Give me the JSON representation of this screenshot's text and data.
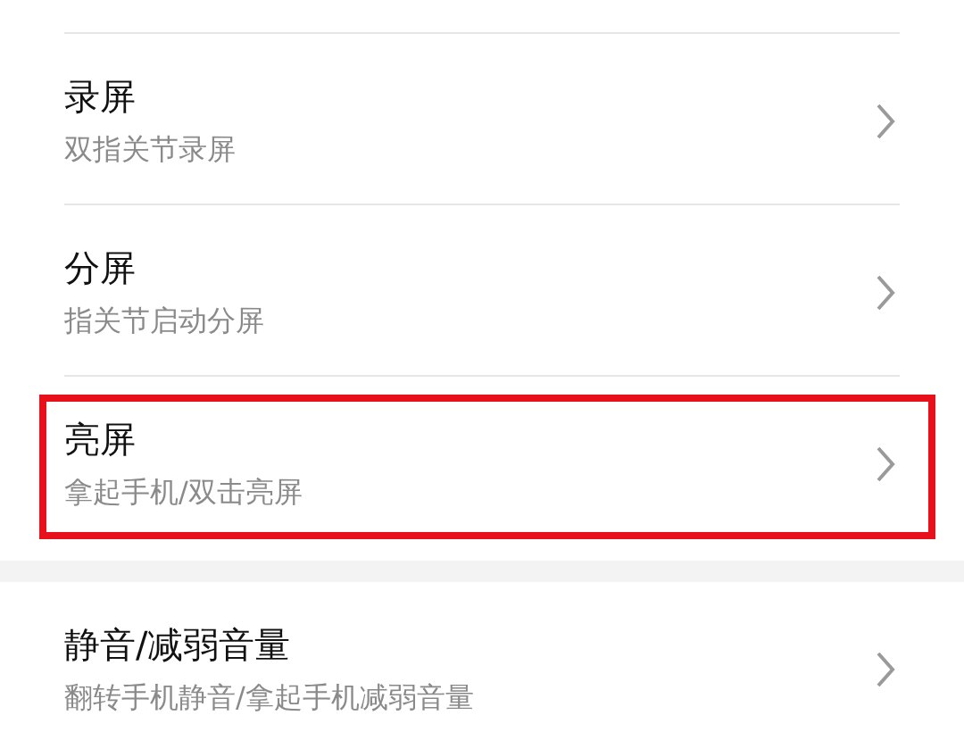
{
  "sections": [
    {
      "items": [
        {
          "title": "录屏",
          "subtitle": "双指关节录屏",
          "highlighted": false
        },
        {
          "title": "分屏",
          "subtitle": "指关节启动分屏",
          "highlighted": false
        },
        {
          "title": "亮屏",
          "subtitle": "拿起手机/双击亮屏",
          "highlighted": true
        }
      ]
    },
    {
      "items": [
        {
          "title": "静音/减弱音量",
          "subtitle": "翻转手机静音/拿起手机减弱音量",
          "highlighted": false
        }
      ]
    }
  ]
}
